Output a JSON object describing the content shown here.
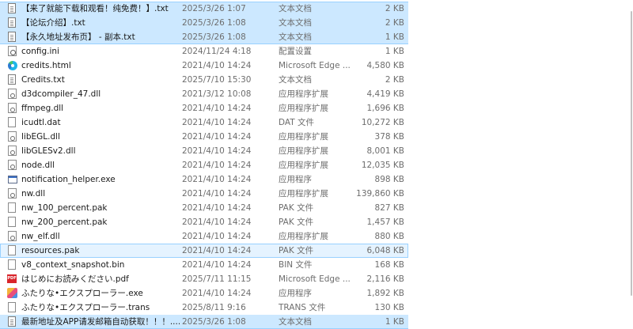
{
  "files": [
    {
      "name": "【来了就能下载和观看！纯免费！】.txt",
      "date": "2025/3/26 1:07",
      "type": "文本文档",
      "size": "2 KB",
      "icon": "text-file-icon",
      "state": "sel selfirst"
    },
    {
      "name": "【论坛介绍】.txt",
      "date": "2025/3/26 1:08",
      "type": "文本文档",
      "size": "2 KB",
      "icon": "text-file-icon",
      "state": "sel"
    },
    {
      "name": "【永久地址发布页】 - 副本.txt",
      "date": "2025/3/26 1:08",
      "type": "文本文档",
      "size": "1 KB",
      "icon": "text-file-icon",
      "state": "sel sellast"
    },
    {
      "name": "config.ini",
      "date": "2024/11/24 4:18",
      "type": "配置设置",
      "size": "1 KB",
      "icon": "settings-file-icon",
      "state": ""
    },
    {
      "name": "credits.html",
      "date": "2021/4/10 14:24",
      "type": "Microsoft Edge ...",
      "size": "4,580 KB",
      "icon": "edge-icon",
      "state": ""
    },
    {
      "name": "Credits.txt",
      "date": "2025/7/10 15:30",
      "type": "文本文档",
      "size": "2 KB",
      "icon": "text-file-icon",
      "state": ""
    },
    {
      "name": "d3dcompiler_47.dll",
      "date": "2021/3/12 10:08",
      "type": "应用程序扩展",
      "size": "4,419 KB",
      "icon": "dll-file-icon",
      "state": ""
    },
    {
      "name": "ffmpeg.dll",
      "date": "2021/4/10 14:24",
      "type": "应用程序扩展",
      "size": "1,696 KB",
      "icon": "dll-file-icon",
      "state": ""
    },
    {
      "name": "icudtl.dat",
      "date": "2021/4/10 14:24",
      "type": "DAT 文件",
      "size": "10,272 KB",
      "icon": "blank-file-icon",
      "state": ""
    },
    {
      "name": "libEGL.dll",
      "date": "2021/4/10 14:24",
      "type": "应用程序扩展",
      "size": "378 KB",
      "icon": "dll-file-icon",
      "state": ""
    },
    {
      "name": "libGLESv2.dll",
      "date": "2021/4/10 14:24",
      "type": "应用程序扩展",
      "size": "8,001 KB",
      "icon": "dll-file-icon",
      "state": ""
    },
    {
      "name": "node.dll",
      "date": "2021/4/10 14:24",
      "type": "应用程序扩展",
      "size": "12,035 KB",
      "icon": "dll-file-icon",
      "state": ""
    },
    {
      "name": "notification_helper.exe",
      "date": "2021/4/10 14:24",
      "type": "应用程序",
      "size": "898 KB",
      "icon": "exe-file-icon",
      "state": ""
    },
    {
      "name": "nw.dll",
      "date": "2021/4/10 14:24",
      "type": "应用程序扩展",
      "size": "139,860 KB",
      "icon": "dll-file-icon",
      "state": ""
    },
    {
      "name": "nw_100_percent.pak",
      "date": "2021/4/10 14:24",
      "type": "PAK 文件",
      "size": "827 KB",
      "icon": "blank-file-icon",
      "state": ""
    },
    {
      "name": "nw_200_percent.pak",
      "date": "2021/4/10 14:24",
      "type": "PAK 文件",
      "size": "1,457 KB",
      "icon": "blank-file-icon",
      "state": ""
    },
    {
      "name": "nw_elf.dll",
      "date": "2021/4/10 14:24",
      "type": "应用程序扩展",
      "size": "880 KB",
      "icon": "dll-file-icon",
      "state": ""
    },
    {
      "name": "resources.pak",
      "date": "2021/4/10 14:24",
      "type": "PAK 文件",
      "size": "6,048 KB",
      "icon": "blank-file-icon",
      "state": "cur"
    },
    {
      "name": "v8_context_snapshot.bin",
      "date": "2021/4/10 14:24",
      "type": "BIN 文件",
      "size": "168 KB",
      "icon": "blank-file-icon",
      "state": ""
    },
    {
      "name": "はじめにお読みください.pdf",
      "date": "2025/7/11 11:15",
      "type": "Microsoft Edge ...",
      "size": "2,116 KB",
      "icon": "pdf-file-icon",
      "state": ""
    },
    {
      "name": "ふたりな•エクスプローラー.exe",
      "date": "2021/4/10 14:24",
      "type": "应用程序",
      "size": "1,892 KB",
      "icon": "app-icon",
      "state": ""
    },
    {
      "name": "ふたりな•エクスプローラー.trans",
      "date": "2025/8/11 9:16",
      "type": "TRANS 文件",
      "size": "130 KB",
      "icon": "blank-file-icon",
      "state": ""
    },
    {
      "name": "最新地址及APP请发邮箱自动获取！！！....",
      "date": "2025/3/26 1:08",
      "type": "文本文档",
      "size": "1 KB",
      "icon": "text-file-icon",
      "state": "sel selfirst sellast"
    }
  ],
  "pdf_icon_text": "PDF"
}
